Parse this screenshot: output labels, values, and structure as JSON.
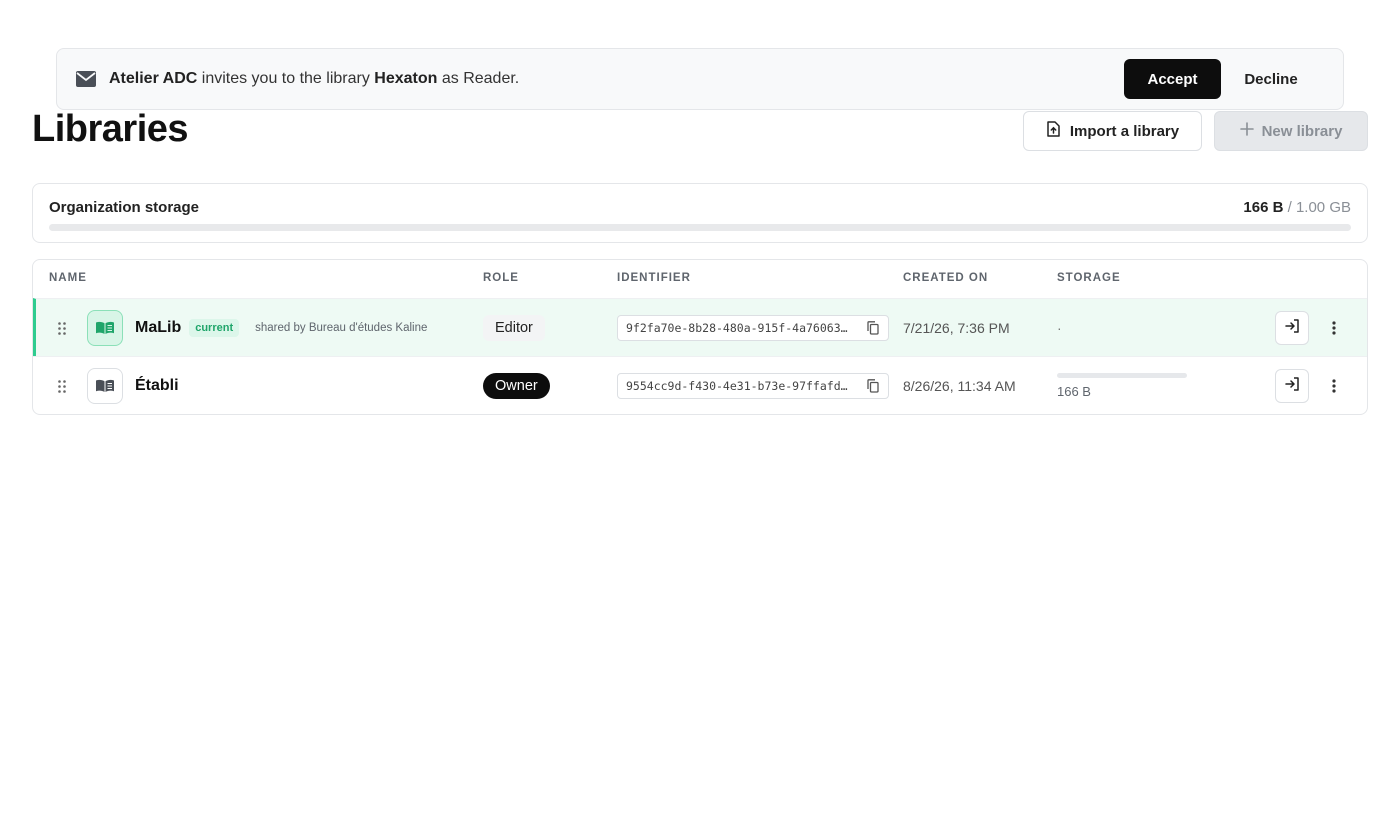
{
  "invite": {
    "inviter": "Atelier ADC",
    "text_1": " invites you to the library ",
    "library": "Hexaton",
    "text_2": " as Reader.",
    "accept_label": "Accept",
    "decline_label": "Decline"
  },
  "header": {
    "title": "Libraries",
    "import_label": "Import a library",
    "new_label": "New library"
  },
  "storage": {
    "label": "Organization storage",
    "used": "166 B",
    "separator": " / ",
    "total": "1.00 GB",
    "used_fraction": 2e-07
  },
  "table": {
    "columns": {
      "name": "NAME",
      "role": "ROLE",
      "identifier": "IDENTIFIER",
      "created": "CREATED ON",
      "storage": "STORAGE"
    },
    "rows": [
      {
        "name": "MaLib",
        "badge": "current",
        "shared": "shared by Bureau d'études Kaline",
        "role": "Editor",
        "identifier": "9f2fa70e-8b28-480a-915f-4a76063…",
        "created": "7/21/26, 7:36 PM",
        "storage": "·"
      },
      {
        "name": "Établi",
        "role": "Owner",
        "identifier": "9554cc9d-f430-4e31-b73e-97ffafd…",
        "created": "8/26/26, 11:34 AM",
        "storage": "166 B",
        "storage_fraction": 0.0
      }
    ]
  },
  "colors": {
    "accent": "#2ecc8f",
    "dark": "#0d0d0d",
    "current_row_bg": "#eefaf4"
  }
}
